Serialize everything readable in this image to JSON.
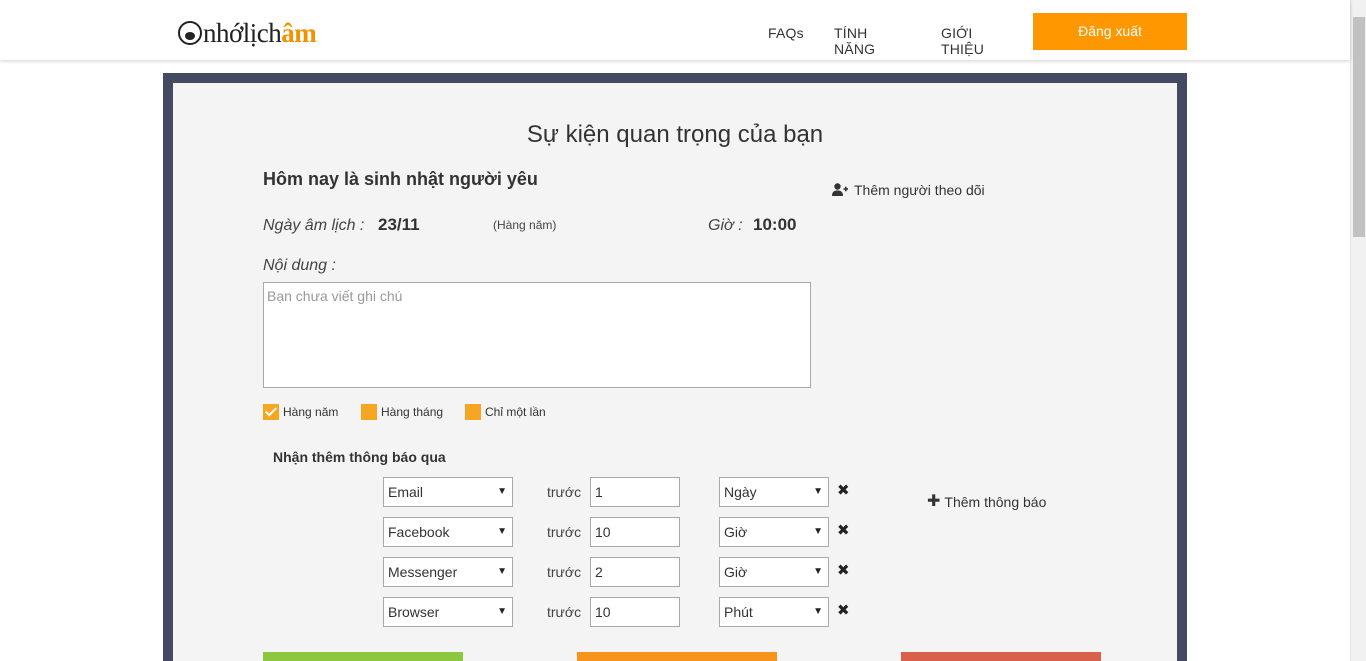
{
  "header": {
    "logo_part1": "nhớlịch",
    "logo_part2": "âm",
    "nav": [
      "FAQs",
      "TÍNH NĂNG",
      "GIỚI THIỆU"
    ],
    "logout_label": "Đăng xuất"
  },
  "page": {
    "title": "Sự kiện quan trọng của bạn",
    "event_name": "Hôm nay là sinh nhật người yêu",
    "add_follower_label": "Thêm người theo dõi",
    "lunar_label": "Ngày âm lịch :",
    "lunar_value": "23/11",
    "repeat_note": "(Hàng năm)",
    "time_label": "Giờ :",
    "time_value": "10:00",
    "content_label": "Nội dung :",
    "content_placeholder": "Bạn chưa viết ghi chú",
    "content_value": ""
  },
  "repeat_options": [
    {
      "label": "Hàng năm",
      "checked": true
    },
    {
      "label": "Hàng tháng",
      "checked": false
    },
    {
      "label": "Chỉ một lần",
      "checked": false
    }
  ],
  "notifications": {
    "title": "Nhận thêm thông báo qua",
    "before_label": "trước",
    "add_label": "Thêm thông báo",
    "rows": [
      {
        "channel": "Email",
        "amount": "1",
        "unit": "Ngày"
      },
      {
        "channel": "Facebook",
        "amount": "10",
        "unit": "Giờ"
      },
      {
        "channel": "Messenger",
        "amount": "2",
        "unit": "Giờ"
      },
      {
        "channel": "Browser",
        "amount": "10",
        "unit": "Phút"
      }
    ]
  },
  "colors": {
    "accent": "#ff9800",
    "frame": "#454a63",
    "btn_green": "#8dc63f",
    "btn_orange": "#f7941d",
    "btn_red": "#d9604a"
  }
}
